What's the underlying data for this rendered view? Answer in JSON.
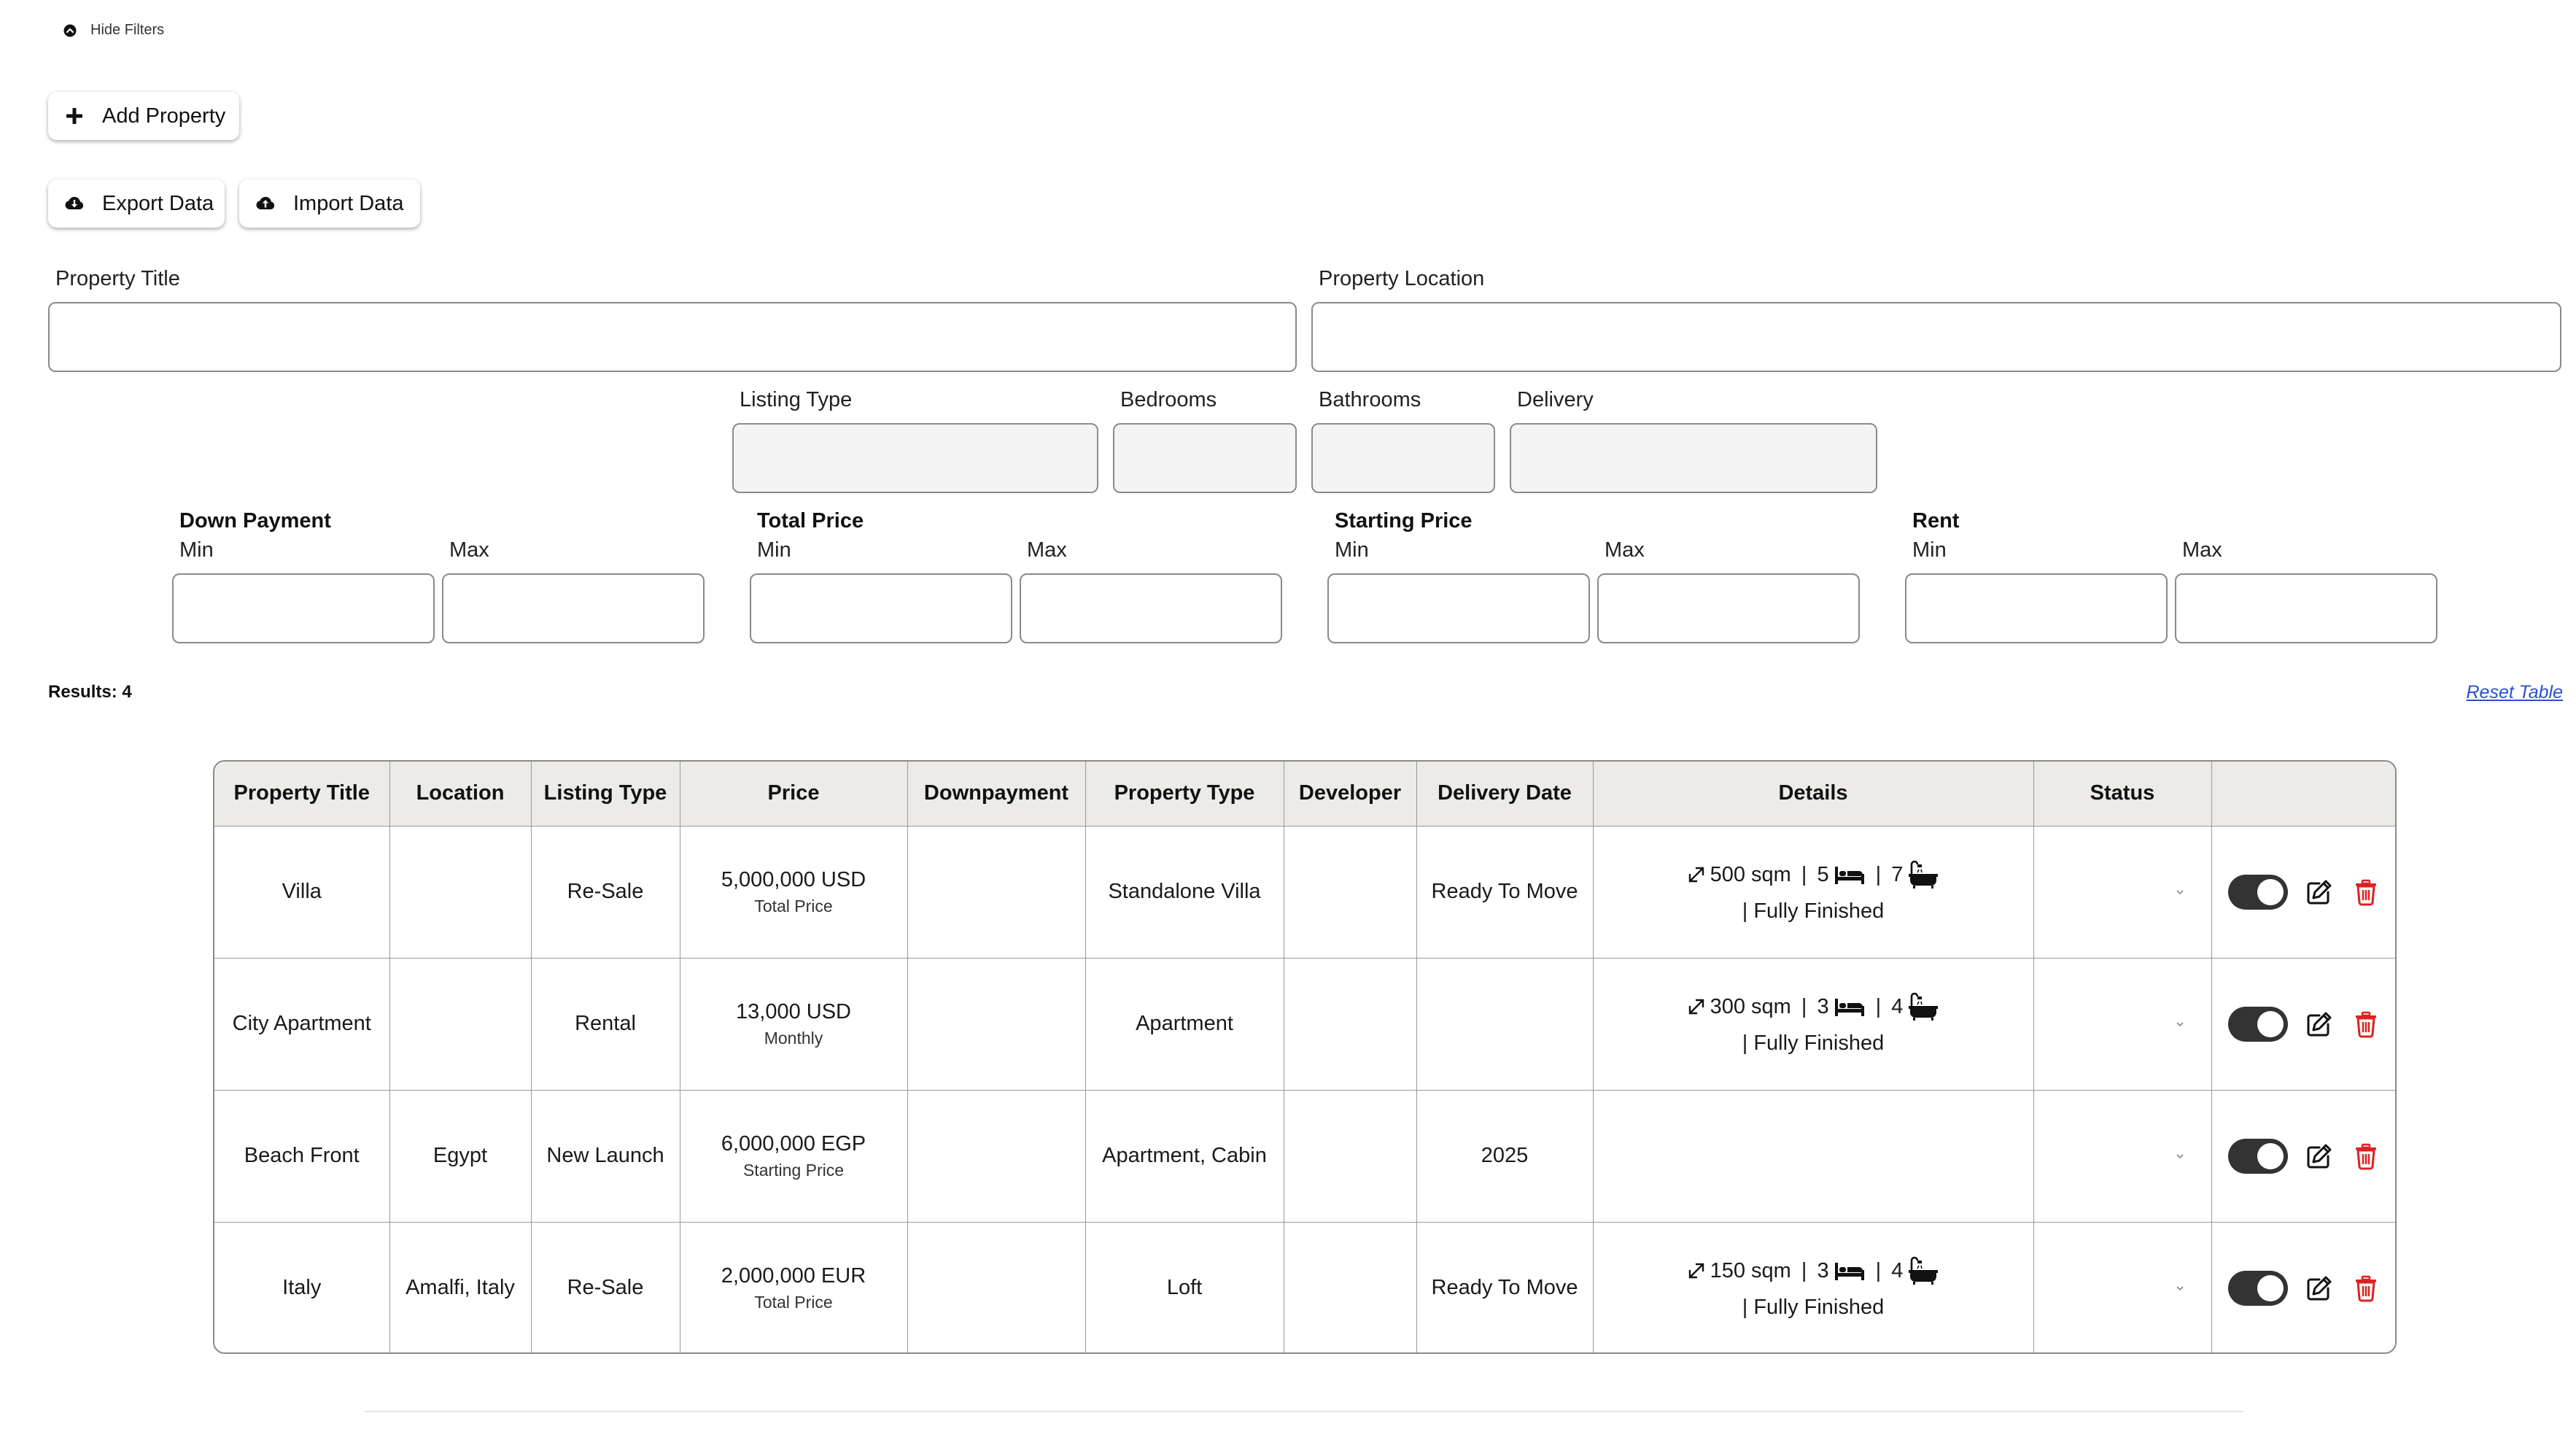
{
  "filters_toggle": {
    "label": "Hide Filters",
    "icon": "chevron-up-circle-icon"
  },
  "toolbar": {
    "add_property": "Add Property",
    "export_data": "Export Data",
    "import_data": "Import Data"
  },
  "filters": {
    "property_title": "Property Title",
    "property_location": "Property Location",
    "listing_type": "Listing Type",
    "bedrooms": "Bedrooms",
    "bathrooms": "Bathrooms",
    "delivery": "Delivery",
    "down_payment": "Down Payment",
    "total_price": "Total Price",
    "starting_price": "Starting Price",
    "rent": "Rent",
    "min": "Min",
    "max": "Max"
  },
  "results_label": "Results: 4",
  "reset_label": "Reset Table",
  "table": {
    "headers": [
      "Property Title",
      "Location",
      "Listing Type",
      "Price",
      "Downpayment",
      "Property Type",
      "Developer",
      "Delivery Date",
      "Details",
      "Status",
      ""
    ],
    "rows": [
      {
        "title": "Villa",
        "location": "",
        "listing_type": "Re-Sale",
        "price": "5,000,000 USD",
        "price_type": "Total Price",
        "downpayment": "",
        "property_type": "Standalone Villa",
        "developer": "",
        "delivery": "Ready To Move",
        "area": "500 sqm",
        "beds": "5",
        "baths": "7",
        "finish": "| Fully Finished",
        "status": ""
      },
      {
        "title": "City Apartment",
        "location": "",
        "listing_type": "Rental",
        "price": "13,000 USD",
        "price_type": "Monthly",
        "downpayment": "",
        "property_type": "Apartment",
        "developer": "",
        "delivery": "",
        "area": "300 sqm",
        "beds": "3",
        "baths": "4",
        "finish": "| Fully Finished",
        "status": ""
      },
      {
        "title": "Beach Front",
        "location": "Egypt",
        "listing_type": "New Launch",
        "price": "6,000,000 EGP",
        "price_type": "Starting Price",
        "downpayment": "",
        "property_type": "Apartment, Cabin",
        "developer": "",
        "delivery": "2025",
        "area": "",
        "beds": "",
        "baths": "",
        "finish": "",
        "status": ""
      },
      {
        "title": "Italy",
        "location": "Amalfi, Italy",
        "listing_type": "Re-Sale",
        "price": "2,000,000 EUR",
        "price_type": "Total Price",
        "downpayment": "",
        "property_type": "Loft",
        "developer": "",
        "delivery": "Ready To Move",
        "area": "150 sqm",
        "beds": "3",
        "baths": "4",
        "finish": "| Fully Finished",
        "status": ""
      }
    ]
  },
  "icons": {
    "add": "plus-icon",
    "export": "cloud-download-icon",
    "import": "cloud-upload-icon",
    "area": "expand-arrow-icon",
    "bed": "bed-icon",
    "bath": "bathtub-icon",
    "toggle": "toggle-switch-icon",
    "edit": "edit-icon",
    "delete": "trash-icon",
    "status": "chevron-down-icon"
  },
  "colors": {
    "header_bg": "#ecebe8",
    "toggle_on": "#333333",
    "delete_red": "#e02020",
    "link_blue": "#2a4fd6"
  }
}
